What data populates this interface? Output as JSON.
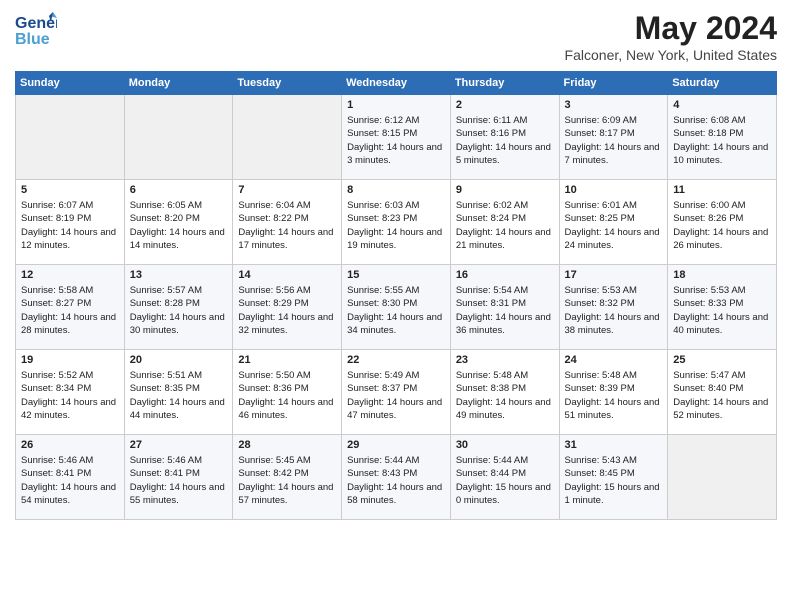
{
  "header": {
    "logo_general": "General",
    "logo_blue": "Blue",
    "month_title": "May 2024",
    "location": "Falconer, New York, United States"
  },
  "days_of_week": [
    "Sunday",
    "Monday",
    "Tuesday",
    "Wednesday",
    "Thursday",
    "Friday",
    "Saturday"
  ],
  "weeks": [
    {
      "cells": [
        {
          "day": "",
          "info": ""
        },
        {
          "day": "",
          "info": ""
        },
        {
          "day": "",
          "info": ""
        },
        {
          "day": "1",
          "info": "Sunrise: 6:12 AM\nSunset: 8:15 PM\nDaylight: 14 hours and 3 minutes."
        },
        {
          "day": "2",
          "info": "Sunrise: 6:11 AM\nSunset: 8:16 PM\nDaylight: 14 hours and 5 minutes."
        },
        {
          "day": "3",
          "info": "Sunrise: 6:09 AM\nSunset: 8:17 PM\nDaylight: 14 hours and 7 minutes."
        },
        {
          "day": "4",
          "info": "Sunrise: 6:08 AM\nSunset: 8:18 PM\nDaylight: 14 hours and 10 minutes."
        }
      ]
    },
    {
      "cells": [
        {
          "day": "5",
          "info": "Sunrise: 6:07 AM\nSunset: 8:19 PM\nDaylight: 14 hours and 12 minutes."
        },
        {
          "day": "6",
          "info": "Sunrise: 6:05 AM\nSunset: 8:20 PM\nDaylight: 14 hours and 14 minutes."
        },
        {
          "day": "7",
          "info": "Sunrise: 6:04 AM\nSunset: 8:22 PM\nDaylight: 14 hours and 17 minutes."
        },
        {
          "day": "8",
          "info": "Sunrise: 6:03 AM\nSunset: 8:23 PM\nDaylight: 14 hours and 19 minutes."
        },
        {
          "day": "9",
          "info": "Sunrise: 6:02 AM\nSunset: 8:24 PM\nDaylight: 14 hours and 21 minutes."
        },
        {
          "day": "10",
          "info": "Sunrise: 6:01 AM\nSunset: 8:25 PM\nDaylight: 14 hours and 24 minutes."
        },
        {
          "day": "11",
          "info": "Sunrise: 6:00 AM\nSunset: 8:26 PM\nDaylight: 14 hours and 26 minutes."
        }
      ]
    },
    {
      "cells": [
        {
          "day": "12",
          "info": "Sunrise: 5:58 AM\nSunset: 8:27 PM\nDaylight: 14 hours and 28 minutes."
        },
        {
          "day": "13",
          "info": "Sunrise: 5:57 AM\nSunset: 8:28 PM\nDaylight: 14 hours and 30 minutes."
        },
        {
          "day": "14",
          "info": "Sunrise: 5:56 AM\nSunset: 8:29 PM\nDaylight: 14 hours and 32 minutes."
        },
        {
          "day": "15",
          "info": "Sunrise: 5:55 AM\nSunset: 8:30 PM\nDaylight: 14 hours and 34 minutes."
        },
        {
          "day": "16",
          "info": "Sunrise: 5:54 AM\nSunset: 8:31 PM\nDaylight: 14 hours and 36 minutes."
        },
        {
          "day": "17",
          "info": "Sunrise: 5:53 AM\nSunset: 8:32 PM\nDaylight: 14 hours and 38 minutes."
        },
        {
          "day": "18",
          "info": "Sunrise: 5:53 AM\nSunset: 8:33 PM\nDaylight: 14 hours and 40 minutes."
        }
      ]
    },
    {
      "cells": [
        {
          "day": "19",
          "info": "Sunrise: 5:52 AM\nSunset: 8:34 PM\nDaylight: 14 hours and 42 minutes."
        },
        {
          "day": "20",
          "info": "Sunrise: 5:51 AM\nSunset: 8:35 PM\nDaylight: 14 hours and 44 minutes."
        },
        {
          "day": "21",
          "info": "Sunrise: 5:50 AM\nSunset: 8:36 PM\nDaylight: 14 hours and 46 minutes."
        },
        {
          "day": "22",
          "info": "Sunrise: 5:49 AM\nSunset: 8:37 PM\nDaylight: 14 hours and 47 minutes."
        },
        {
          "day": "23",
          "info": "Sunrise: 5:48 AM\nSunset: 8:38 PM\nDaylight: 14 hours and 49 minutes."
        },
        {
          "day": "24",
          "info": "Sunrise: 5:48 AM\nSunset: 8:39 PM\nDaylight: 14 hours and 51 minutes."
        },
        {
          "day": "25",
          "info": "Sunrise: 5:47 AM\nSunset: 8:40 PM\nDaylight: 14 hours and 52 minutes."
        }
      ]
    },
    {
      "cells": [
        {
          "day": "26",
          "info": "Sunrise: 5:46 AM\nSunset: 8:41 PM\nDaylight: 14 hours and 54 minutes."
        },
        {
          "day": "27",
          "info": "Sunrise: 5:46 AM\nSunset: 8:41 PM\nDaylight: 14 hours and 55 minutes."
        },
        {
          "day": "28",
          "info": "Sunrise: 5:45 AM\nSunset: 8:42 PM\nDaylight: 14 hours and 57 minutes."
        },
        {
          "day": "29",
          "info": "Sunrise: 5:44 AM\nSunset: 8:43 PM\nDaylight: 14 hours and 58 minutes."
        },
        {
          "day": "30",
          "info": "Sunrise: 5:44 AM\nSunset: 8:44 PM\nDaylight: 15 hours and 0 minutes."
        },
        {
          "day": "31",
          "info": "Sunrise: 5:43 AM\nSunset: 8:45 PM\nDaylight: 15 hours and 1 minute."
        },
        {
          "day": "",
          "info": ""
        }
      ]
    }
  ]
}
